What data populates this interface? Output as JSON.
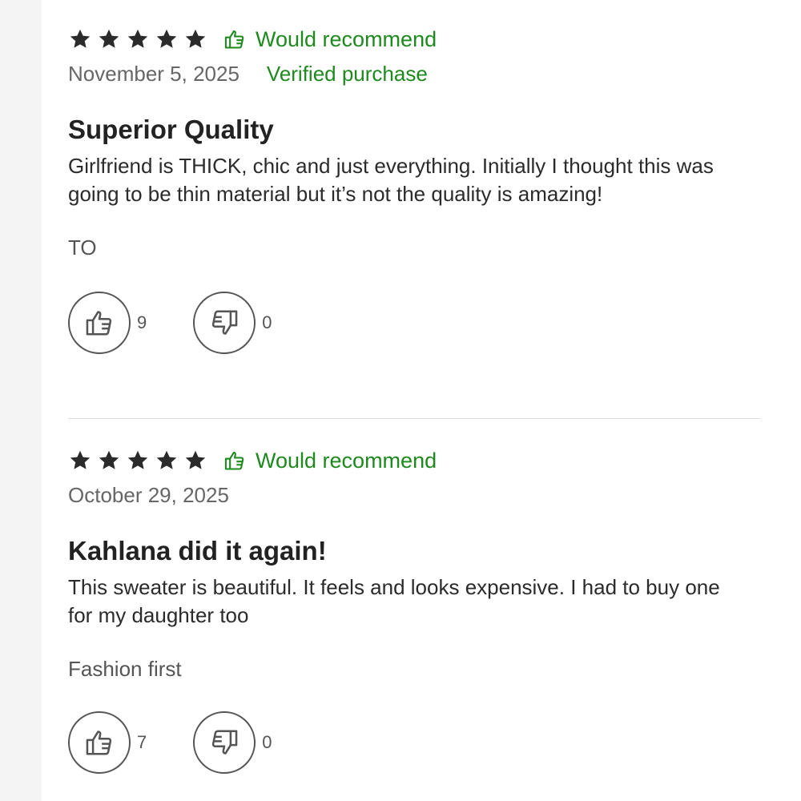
{
  "colors": {
    "accent_green": "#1e8a1e",
    "star": "#2b2b2b",
    "text": "#222222",
    "muted": "#666666"
  },
  "reviews": [
    {
      "rating": 5,
      "recommend_icon": "thumbs-up-icon",
      "recommend_label": "Would recommend",
      "date": "November 5, 2025",
      "verified_label": "Verified purchase",
      "title": "Superior Quality",
      "body": "Girlfriend is THICK, chic and just everything. Initially I thought this was going to be thin material but it’s not the quality is amazing!",
      "author": "TO",
      "helpful_count": "9",
      "unhelpful_count": "0"
    },
    {
      "rating": 5,
      "recommend_icon": "thumbs-up-icon",
      "recommend_label": "Would recommend",
      "date": "October 29, 2025",
      "verified_label": "",
      "title": "Kahlana did it again!",
      "body": "This sweater is beautiful. It feels and looks expensive. I had to buy one for my daughter too",
      "author": "Fashion first",
      "helpful_count": "7",
      "unhelpful_count": "0"
    }
  ]
}
